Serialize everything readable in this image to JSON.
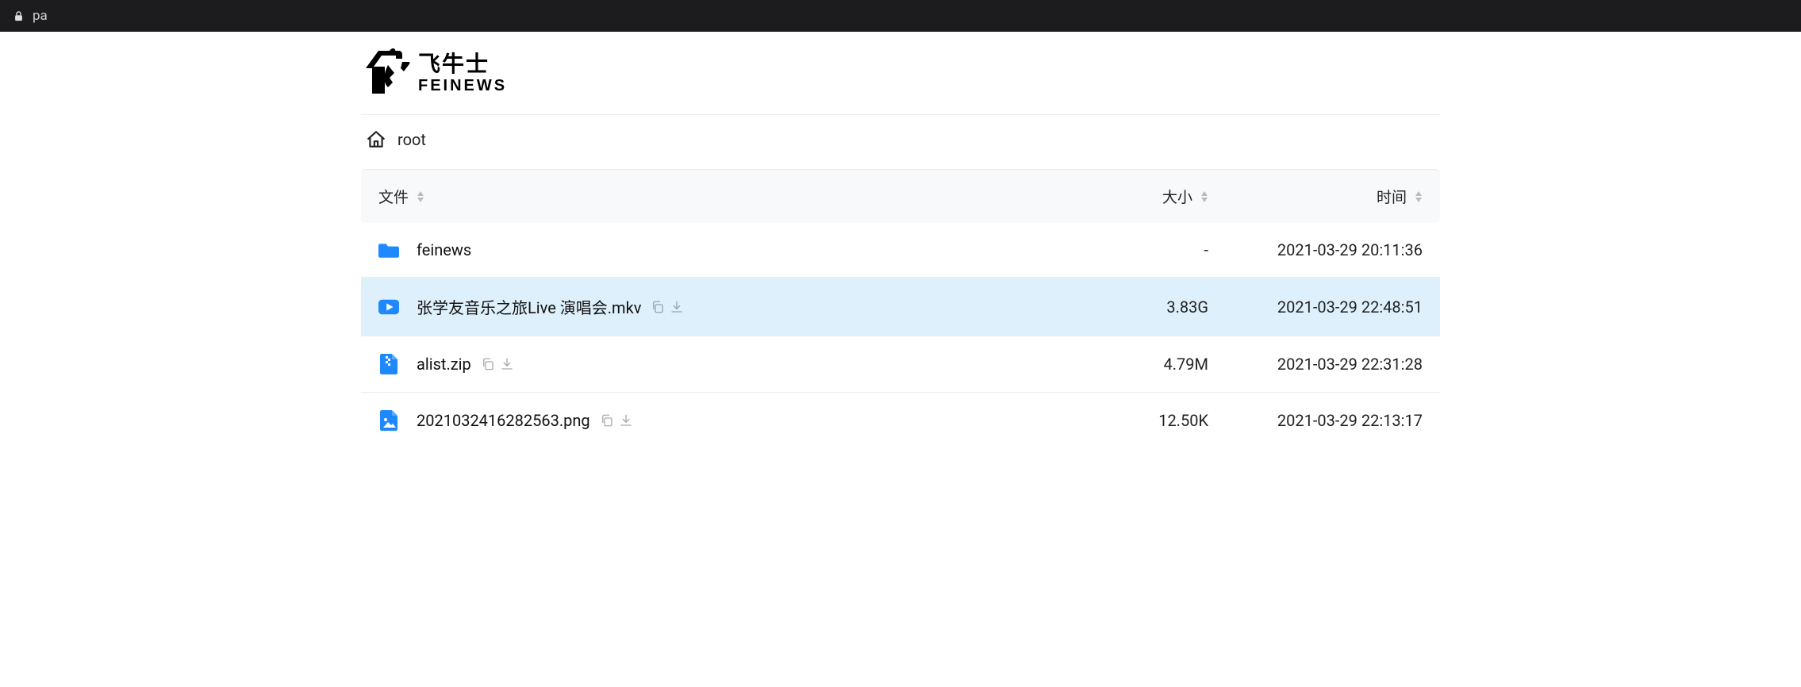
{
  "browser": {
    "url_fragment": "pa"
  },
  "brand": {
    "name": "飞牛士",
    "name_en": "FEINEWS"
  },
  "breadcrumb": {
    "root_label": "root"
  },
  "columns": {
    "name": "文件",
    "size": "大小",
    "time": "时间"
  },
  "files": [
    {
      "type": "folder",
      "name": "feinews",
      "size": "-",
      "time": "2021-03-29 20:11:36",
      "actions": false,
      "highlight": false
    },
    {
      "type": "video",
      "name": "张学友音乐之旅Live 演唱会.mkv",
      "size": "3.83G",
      "time": "2021-03-29 22:48:51",
      "actions": true,
      "highlight": true
    },
    {
      "type": "zip",
      "name": "alist.zip",
      "size": "4.79M",
      "time": "2021-03-29 22:31:28",
      "actions": true,
      "highlight": false
    },
    {
      "type": "image",
      "name": "2021032416282563.png",
      "size": "12.50K",
      "time": "2021-03-29 22:13:17",
      "actions": true,
      "highlight": false
    }
  ]
}
